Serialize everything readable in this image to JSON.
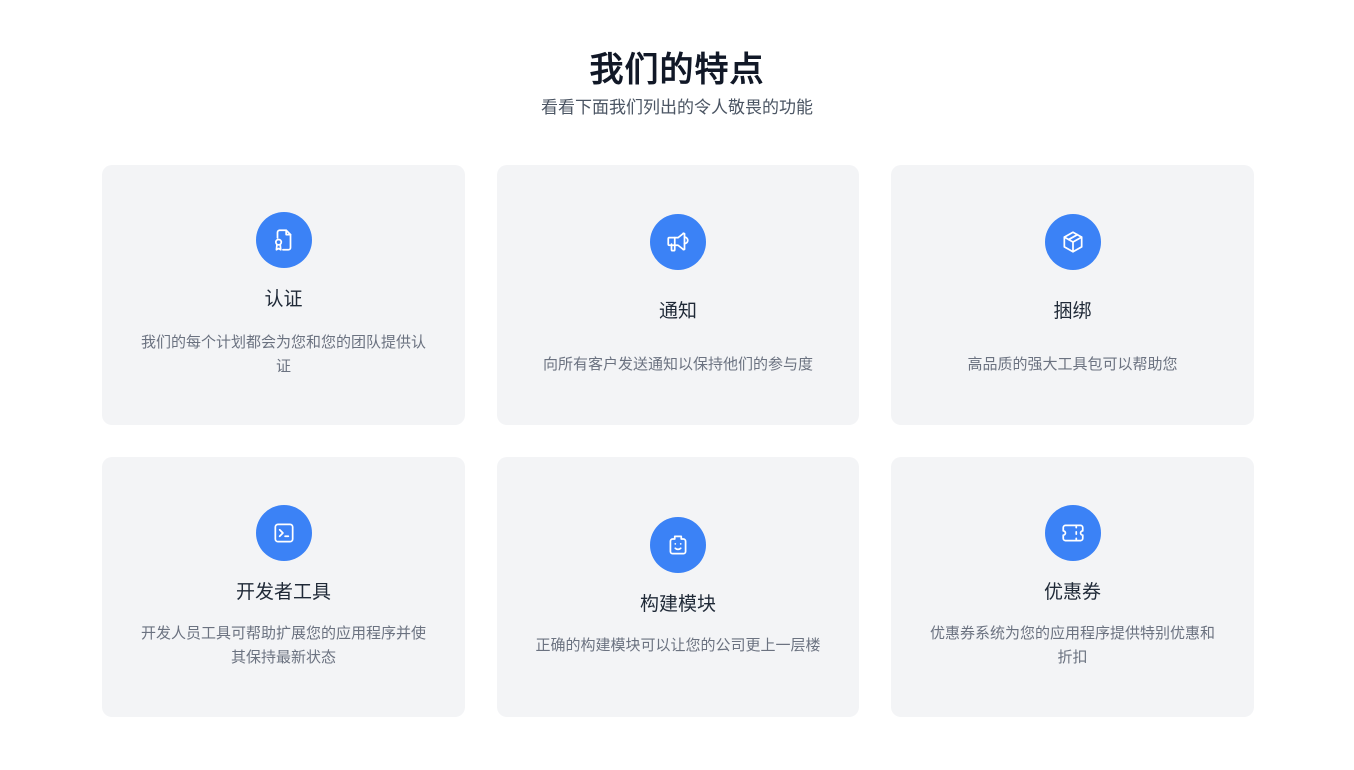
{
  "section": {
    "title": "我们的特点",
    "subtitle": "看看下面我们列出的令人敬畏的功能"
  },
  "features": [
    {
      "icon": "certificate-icon",
      "title": "认证",
      "description": "我们的每个计划都会为您和您的团队提供认证"
    },
    {
      "icon": "megaphone-icon",
      "title": "通知",
      "description": "向所有客户发送通知以保持他们的参与度"
    },
    {
      "icon": "box-icon",
      "title": "捆绑",
      "description": "高品质的强大工具包可以帮助您"
    },
    {
      "icon": "terminal-icon",
      "title": "开发者工具",
      "description": "开发人员工具可帮助扩展您的应用程序并使其保持最新状态"
    },
    {
      "icon": "lego-face-icon",
      "title": "构建模块",
      "description": "正确的构建模块可以让您的公司更上一层楼"
    },
    {
      "icon": "ticket-icon",
      "title": "优惠券",
      "description": "优惠券系统为您的应用程序提供特别优惠和折扣"
    }
  ],
  "colors": {
    "accent": "#3b82f6",
    "card_background": "#f3f4f6",
    "title_text": "#111827",
    "body_text": "#6b7280"
  }
}
